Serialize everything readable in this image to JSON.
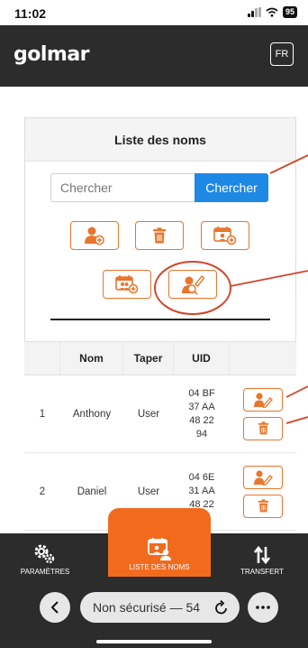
{
  "status_bar": {
    "time": "11:02",
    "battery": "95"
  },
  "header": {
    "logo": "golmar",
    "lang_button": "FR"
  },
  "names_list": {
    "title": "Liste des noms",
    "search": {
      "placeholder": "Chercher",
      "value": "",
      "button_label": "Chercher"
    }
  },
  "table": {
    "headers": [
      "",
      "Nom",
      "Taper",
      "UID",
      ""
    ],
    "rows": [
      {
        "index": "1",
        "name": "Anthony",
        "type": "User",
        "uid": [
          "04 BF",
          "37 AA",
          "48 22",
          "94"
        ]
      },
      {
        "index": "2",
        "name": "Daniel",
        "type": "User",
        "uid": [
          "04 6E",
          "31 AA",
          "48 22",
          ""
        ]
      }
    ]
  },
  "bottom_nav": {
    "items": [
      {
        "label": "PARAMÈTRES",
        "icon": "gears-icon"
      },
      {
        "label": "LISTE DES NOMS",
        "icon": "calendar-users-icon",
        "active": true
      },
      {
        "label": "TRANSFERT",
        "icon": "transfer-arrows-icon"
      }
    ]
  },
  "browser": {
    "url_text": "Non sécurisé — ",
    "url_suffix": "54"
  },
  "colors": {
    "header_bg": "#2c2c2c",
    "accent_orange": "#f26b1d",
    "button_border_orange": "#e8762c",
    "search_blue": "#1e88e5",
    "annotation_red": "#d2442a"
  }
}
